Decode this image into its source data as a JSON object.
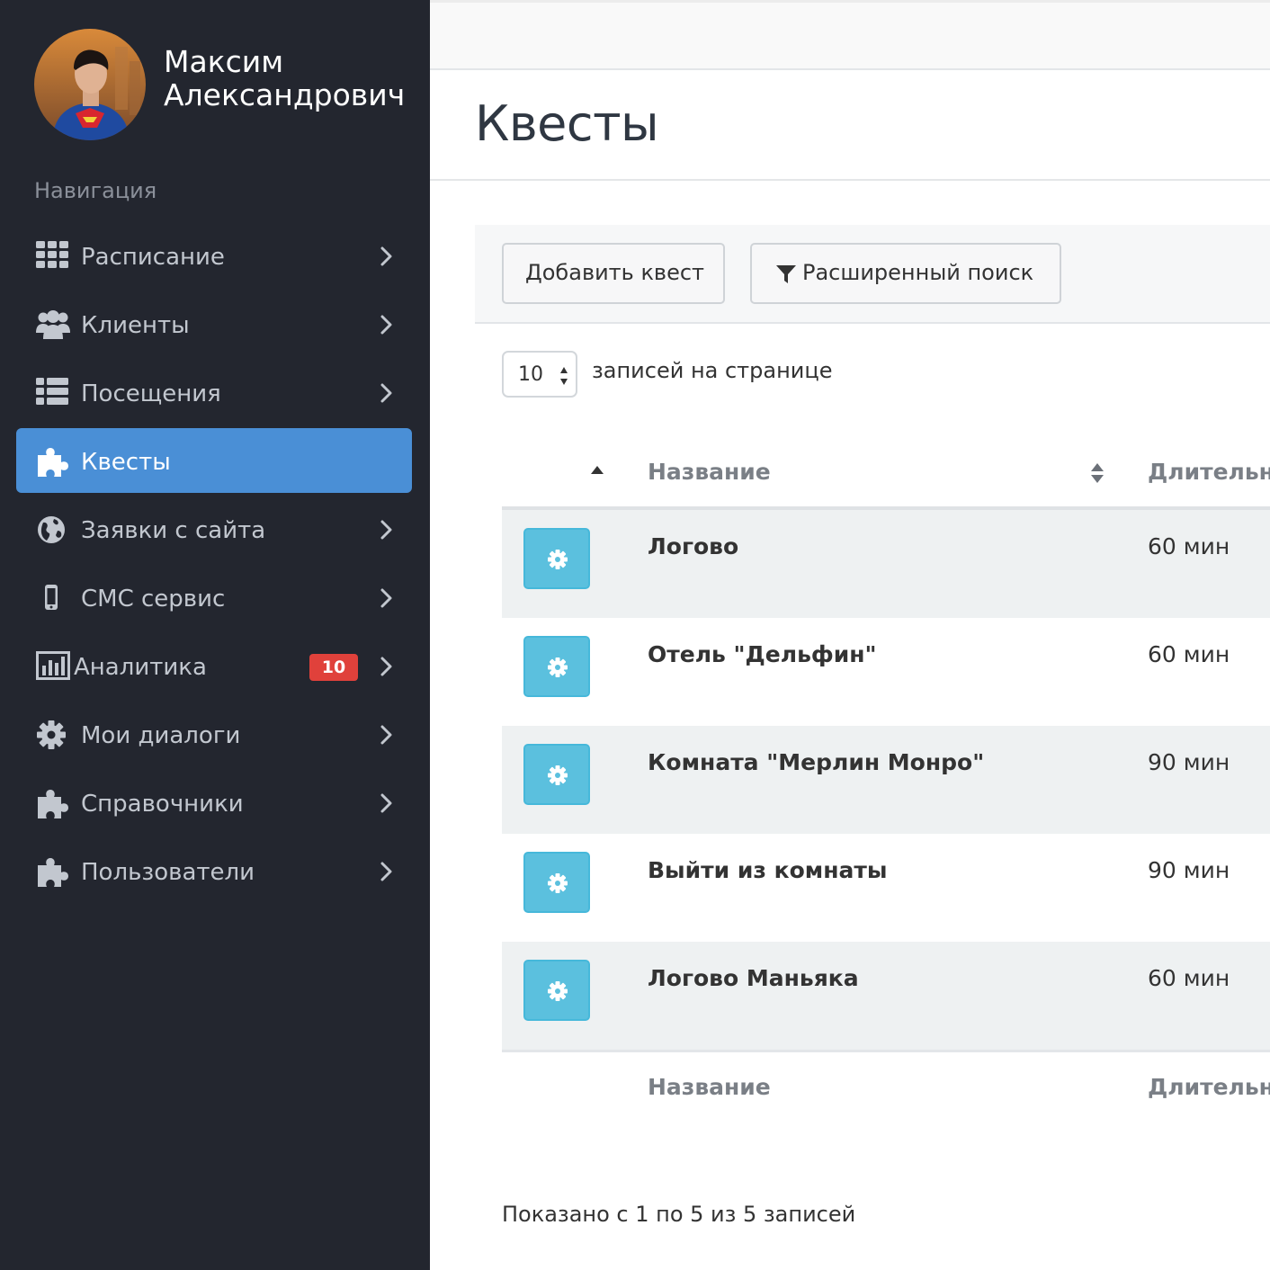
{
  "user": {
    "name": "Максим Александрович"
  },
  "nav": {
    "heading": "Навигация",
    "items": [
      {
        "label": "Расписание",
        "icon": "grid-icon",
        "active": false
      },
      {
        "label": "Клиенты",
        "icon": "users-icon",
        "active": false
      },
      {
        "label": "Посещения",
        "icon": "list-icon",
        "active": false
      },
      {
        "label": "Квесты",
        "icon": "puzzle-icon",
        "active": true
      },
      {
        "label": "Заявки с сайта",
        "icon": "globe-icon",
        "active": false
      },
      {
        "label": "СМС сервис",
        "icon": "mobile-icon",
        "active": false
      },
      {
        "label": "Аналитика",
        "icon": "bar-chart-icon",
        "active": false,
        "badge": "10"
      },
      {
        "label": "Мои диалоги",
        "icon": "gear-icon",
        "active": false
      },
      {
        "label": "Справочники",
        "icon": "puzzle-icon",
        "active": false
      },
      {
        "label": "Пользователи",
        "icon": "puzzle-icon",
        "active": false
      }
    ]
  },
  "page": {
    "title": "Квесты"
  },
  "toolbar": {
    "add_label": "Добавить квест",
    "search_label": "Расширенный поиск"
  },
  "page_size": {
    "value": "10",
    "label": "записей на странице"
  },
  "table": {
    "columns": [
      "Название",
      "Длительность"
    ],
    "rows": [
      {
        "name": "Логово",
        "duration": "60 мин"
      },
      {
        "name": "Отель \"Дельфин\"",
        "duration": "60 мин"
      },
      {
        "name": "Комната \"Мерлин Монро\"",
        "duration": "90 мин"
      },
      {
        "name": "Выйти из комнаты",
        "duration": "90 мин"
      },
      {
        "name": "Логово Маньяка",
        "duration": "60 мин"
      }
    ]
  },
  "info": "Показано с 1 по 5 из 5 записей",
  "colors": {
    "sidebar_bg": "#23262f",
    "active_item": "#4a8fd6",
    "badge": "#e0413b",
    "row_button": "#5bc0de"
  }
}
